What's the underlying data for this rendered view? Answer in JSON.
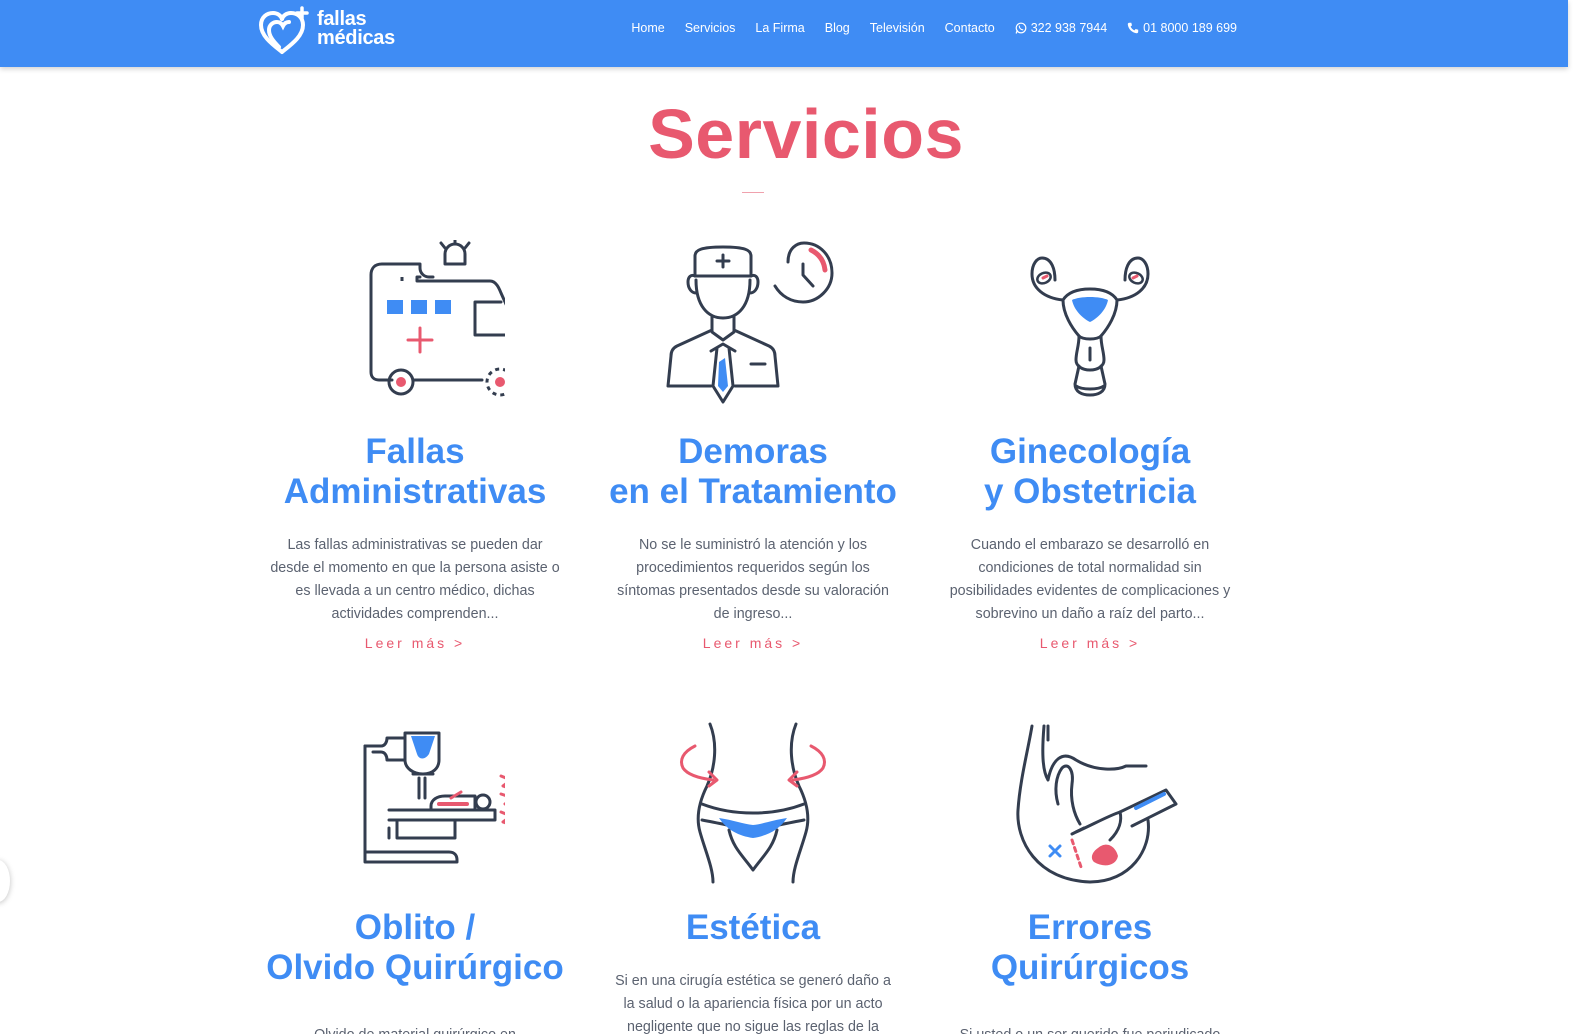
{
  "header": {
    "logo": {
      "line1": "fallas",
      "line2": "médicas"
    },
    "nav": [
      {
        "label": "Home"
      },
      {
        "label": "Servicios"
      },
      {
        "label": "La Firma"
      },
      {
        "label": "Blog"
      },
      {
        "label": "Televisión"
      },
      {
        "label": "Contacto"
      },
      {
        "label": "322 938 7944",
        "icon": "whatsapp-icon"
      },
      {
        "label": "01 8000 189 699",
        "icon": "phone-icon"
      }
    ]
  },
  "page": {
    "title": "Servicios"
  },
  "services": [
    {
      "title_line1": "Fallas",
      "title_line2": "Administrativas",
      "description": "Las fallas administrativas se pueden dar desde el momento en que la persona asiste o es llevada a un centro médico, dichas actividades comprenden...",
      "more": "Leer más >",
      "icon": "ambulance-icon"
    },
    {
      "title_line1": "Demoras",
      "title_line2": "en el Tratamiento",
      "description": "No se le suministró la atención y los procedimientos requeridos según los síntomas presentados desde su valoración de ingreso...",
      "more": "Leer más >",
      "icon": "doctor-clock-icon"
    },
    {
      "title_line1": "Ginecología",
      "title_line2": "y Obstetricia",
      "description": "Cuando el embarazo se desarrolló en condiciones de total normalidad sin posibilidades evidentes de complicaciones y sobrevino un daño a raíz del parto...",
      "more": "Leer más >",
      "icon": "uterus-icon"
    },
    {
      "title_line1": "Oblito /",
      "title_line2": "Olvido Quirúrgico",
      "description": "Olvido de material quirúrgico en",
      "icon": "surgical-scanner-icon"
    },
    {
      "title_line1": "Estética",
      "title_line2": "",
      "description": "Si en una cirugía estética se generó daño a la salud o la apariencia física por un acto negligente que no sigue las reglas de la",
      "icon": "body-contour-icon"
    },
    {
      "title_line1": "Errores",
      "title_line2": "Quirúrgicos",
      "description": "Si usted o un ser querido fue perjudicado",
      "icon": "surgery-scalpel-icon"
    }
  ],
  "colors": {
    "header_bg": "#3f8cf4",
    "title": "#e8596f",
    "service_title": "#3f8cf4",
    "link": "#e8596f",
    "icon_stroke": "#333d4f"
  }
}
